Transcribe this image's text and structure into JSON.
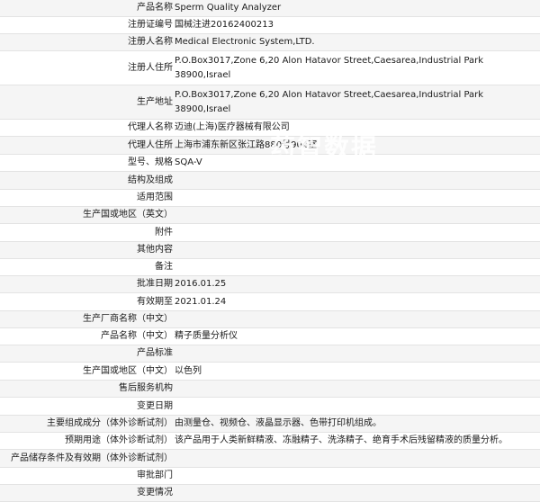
{
  "rows": [
    {
      "label": "产品名称",
      "value": "Sperm Quality Analyzer"
    },
    {
      "label": "注册证编号",
      "value": "国械注进20162400213"
    },
    {
      "label": "注册人名称",
      "value": "Medical Electronic System,LTD."
    },
    {
      "label": "注册人住所",
      "value": "P.O.Box3017,Zone 6,20 Alon Hatavor Street,Caesarea,Industrial Park 38900,Israel"
    },
    {
      "label": "生产地址",
      "value": "P.O.Box3017,Zone 6,20 Alon Hatavor Street,Caesarea,Industrial Park 38900,Israel"
    },
    {
      "label": "代理人名称",
      "value": "迈迪(上海)医疗器械有限公司"
    },
    {
      "label": "代理人住所",
      "value": "上海市浦东新区张江路880号904室"
    },
    {
      "label": "型号、规格",
      "value": "SQA-V"
    },
    {
      "label": "结构及组成",
      "value": ""
    },
    {
      "label": "适用范围",
      "value": ""
    },
    {
      "label": "生产国或地区（英文）",
      "value": ""
    },
    {
      "label": "附件",
      "value": ""
    },
    {
      "label": "其他内容",
      "value": ""
    },
    {
      "label": "备注",
      "value": ""
    },
    {
      "label": "批准日期",
      "value": "2016.01.25"
    },
    {
      "label": "有效期至",
      "value": "2021.01.24"
    },
    {
      "label": "生产厂商名称（中文）",
      "value": ""
    },
    {
      "label": "产品名称（中文）",
      "value": "精子质量分析仪"
    },
    {
      "label": "产品标准",
      "value": ""
    },
    {
      "label": "生产国或地区（中文）",
      "value": "以色列"
    },
    {
      "label": "售后服务机构",
      "value": ""
    },
    {
      "label": "变更日期",
      "value": ""
    },
    {
      "label": "主要组成成分（体外诊断试剂）",
      "value": "由测量仓、视频仓、液晶显示器、色带打印机组成。"
    },
    {
      "label": "预期用途（体外诊断试剂）",
      "value": "该产品用于人类新鲜精液、冻融精子、洗涤精子、绝育手术后残留精液的质量分析。"
    },
    {
      "label": "产品储存条件及有效期（体外诊断试剂）",
      "value": ""
    },
    {
      "label": "审批部门",
      "value": ""
    },
    {
      "label": "变更情况",
      "value": ""
    }
  ],
  "watermark": "药智数据"
}
